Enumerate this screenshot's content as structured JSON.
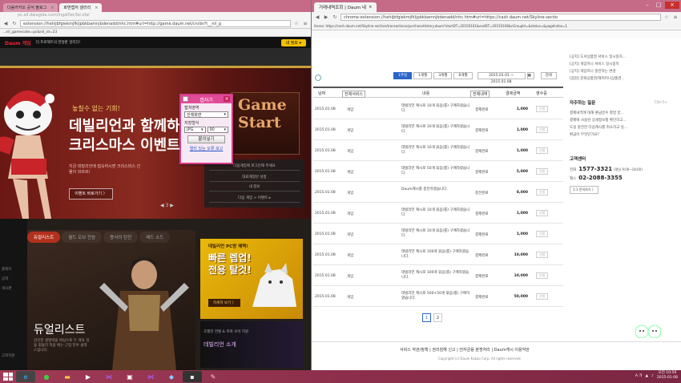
{
  "left_window": {
    "tabs": [
      {
        "label": "다음카카오 공식 블로그",
        "active": false
      },
      {
        "label": "화면캡처 갤러리",
        "active": true
      }
    ],
    "ghost_url": "pc.all.daiagida.com/ingalflar/fal.ofal",
    "url": "extension://hehijbfgiekmjfkljpbkbamnjbdenadd/nhc.htm#url=http://game.daum.net/cn/dv?t__nil_g",
    "url2": "...nil_gamecate=pc&nil_id=23",
    "game_nav": {
      "logo": "Daum 게임",
      "notice": "더 프로젝트의 한정판 알리다!",
      "myinfo": "내 정보 ▾"
    },
    "banner": {
      "chance": "놓칠수 없는 기회!",
      "title_line1": "데빌리언과 함께하",
      "title_line2": "크리스마스 이벤트",
      "desc": "지금 데빌리언에 접속하시면 크리스마스 선물이 와르르!",
      "event_button": "이벤트 바로가기 〉",
      "game_start": "Game Start",
      "side_lines": [
        "다음게임에 로그인해 주세요",
        "대표계정만 설정",
        "내 정보",
        "다음 게임 > 이벤트 ▸"
      ],
      "pager": "◀ 3 ▶"
    },
    "lower": {
      "left_links": [
        "플레이",
        "공략",
        "게시판",
        "고객지원"
      ],
      "duel_tabs": [
        "듀얼리스트",
        "월드 오브 전승",
        "용사의 탄전",
        "레드 소드"
      ],
      "duel_title": "듀얼리스트",
      "duel_desc": "강인한 생명력을 바탕으로 두 개의 검을 휘둘러 적을 베는 근접 전투 클래스입니다.",
      "pc_title": "데빌리언 PC방 혜택!",
      "pc_big": "빠른 렙업! 전용 탈것!",
      "pc_button": "자세히 보기 〉",
      "dark_small": "초월한 천벌 & 축복 보석 지원",
      "dark_big": "데빌리언 소개"
    }
  },
  "capture_tool": {
    "title": "캡쳐기",
    "area_label": "캡쳐영역",
    "area_value": "전체화면",
    "format_label": "저장형식",
    "format_value": "JPG",
    "quality_value": "90",
    "copy_button": "클립보드에 복사",
    "copy_button_short": "붙여넣기",
    "link": "멀리 있는 오류 보고"
  },
  "right_window": {
    "tab_label": "거래내역조회 | Daum 내",
    "url": "chrome-extension://hehijbfgiekmjfkljpbkbamnjbdenadd/nhc.htm#url=https://cash.daum.net/Skyline-sectio",
    "url2": "itness: https://cash.daum.net/Skyline-section/transactions/purchaseHistory.daum?startDT=20150101&endDT=20150108&cGroupId=&status=&pageIndex=1",
    "filter": {
      "periods": [
        "1주일",
        "1개월",
        "3개월",
        "6개월"
      ],
      "active_period": "1주일",
      "date_range": "2015.01.01 ~ 2015.01.08",
      "search": "검색"
    },
    "columns": {
      "date": "날짜",
      "type": "전체서비스",
      "desc": "내용",
      "status": "전체내역",
      "amount": "결제금액",
      "receipt": "영수증"
    },
    "rows": [
      {
        "date": "2015.01.08",
        "type": "게임",
        "desc": "데빌리언 캐시로 10개 묶음(를) 구매하였습니다.",
        "status": "결제완료",
        "amount": "1,000",
        "receipt": "신청"
      },
      {
        "date": "2015.01.08",
        "type": "게임",
        "desc": "데빌리언 캐시로 10개 묶음(를) 구매하였습니다.",
        "status": "결제완료",
        "amount": "1,000",
        "receipt": "신청"
      },
      {
        "date": "2015.01.08",
        "type": "게임",
        "desc": "데빌리언 캐시로 10개 묶음(를) 구매하였습니다.",
        "status": "결제완료",
        "amount": "1,000",
        "receipt": "신청"
      },
      {
        "date": "2015.01.08",
        "type": "게임",
        "desc": "데빌리언 캐시로 50개 묶음(를) 구매하였습니다.",
        "status": "결제완료",
        "amount": "5,000",
        "receipt": "신청"
      },
      {
        "date": "2015.01.08",
        "type": "게임",
        "desc": "Daum캐시를 충전하였습니다.",
        "status": "충전완료",
        "amount": "8,000",
        "receipt": "신청"
      },
      {
        "date": "2015.01.08",
        "type": "게임",
        "desc": "데빌리언 캐시로 10개 묶음(를) 구매하였습니다.",
        "status": "결제완료",
        "amount": "1,000",
        "receipt": "신청"
      },
      {
        "date": "2015.01.08",
        "type": "게임",
        "desc": "데빌리언 캐시로 10개 묶음(를) 구매하였습니다.",
        "status": "결제완료",
        "amount": "1,000",
        "receipt": "신청"
      },
      {
        "date": "2015.01.08",
        "type": "게임",
        "desc": "데빌리언 캐시로 100개 묶음(를) 구매하였습니다.",
        "status": "결제완료",
        "amount": "10,000",
        "receipt": "신청"
      },
      {
        "date": "2015.01.08",
        "type": "게임",
        "desc": "데빌리언 캐시로 100개 묶음(를) 구매하였습니다.",
        "status": "결제완료",
        "amount": "10,000",
        "receipt": "신청"
      },
      {
        "date": "2015.01.08",
        "type": "게임",
        "desc": "데빌리언 캐시로 500+50개 묶음(를) 구매하였습니다.",
        "status": "결제완료",
        "amount": "50,000",
        "receipt": "신청"
      }
    ],
    "pages": [
      "1",
      "2"
    ],
    "active_page": "1",
    "notices": [
      "[공지] 도서상품권 서비스 일시중지...",
      "[공지] 게임머니 서비스 일시중지",
      "[공지] 게임머니 충전하는 변경",
      "[점검] 문화상품권/해피머니상품권..."
    ],
    "faq_title": "자주하는 질문",
    "faq_more": "더보기+",
    "faqs": [
      "결제내역에 대해 환급받수 할방 받...",
      "결제에 사용된 상세정보를 확인하고...",
      "도실 충전한 다음캐시를 취소하고 싶...",
      "환급이 무엇인가요?"
    ],
    "center_title": "고객센터",
    "phone1_label": "전화",
    "phone1": "1577-3321",
    "phone1_hours": "(평일 9:00~18:00)",
    "phone2_label": "팩스",
    "phone2": "02-2088-3355",
    "inquiry_button": "1:1 문의하기 〉",
    "footer_links": "서비스 약관/정책 | 권리침해 신고 | 전자금융 분쟁처리 | Daum캐시 이용약관",
    "copyright": "Copyright (c) Daum Kakao Corp. All rights reserved."
  },
  "taskbar": {
    "clock_time": "오전 10:59",
    "clock_date": "2015-01-08",
    "lang": "A 가"
  }
}
